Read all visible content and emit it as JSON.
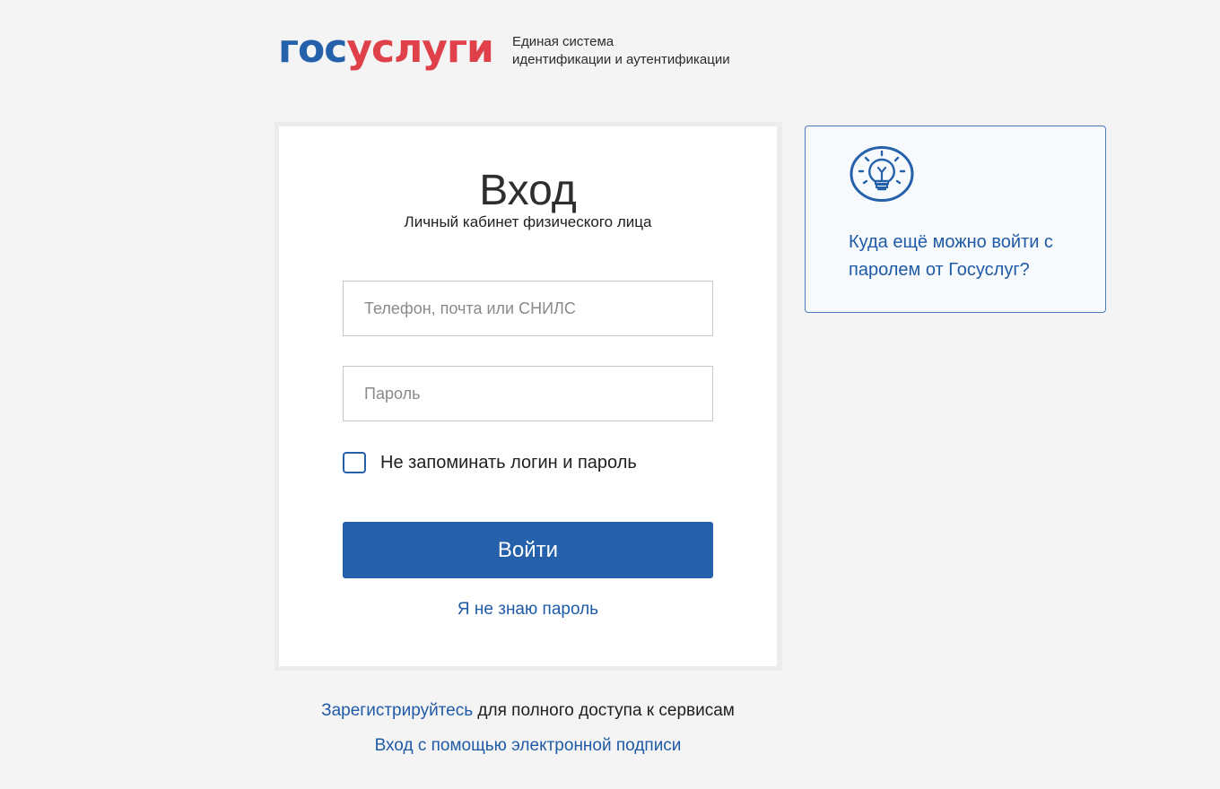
{
  "colors": {
    "brand_blue": "#2560ab",
    "brand_red": "#e0404a",
    "link": "#1f5aa6"
  },
  "header": {
    "logo": {
      "part1": "гос",
      "part2": "услуги"
    },
    "tagline_line1": "Единая система",
    "tagline_line2": "идентификации и аутентификации"
  },
  "login": {
    "title": "Вход",
    "subtitle": "Личный кабинет физического лица",
    "login_placeholder": "Телефон, почта или СНИЛС",
    "password_placeholder": "Пароль",
    "remember_label": "Не запоминать логин и пароль",
    "remember_checked": false,
    "submit_label": "Войти",
    "forgot_label": "Я не знаю пароль"
  },
  "info": {
    "icon": "lightbulb-icon",
    "link_text": "Куда ещё можно войти с паролем от Госуслуг?"
  },
  "footer": {
    "register_link": "Зарегистрируйтесь",
    "register_rest": " для полного доступа к сервисам",
    "esign_link": "Вход с помощью электронной подписи"
  }
}
